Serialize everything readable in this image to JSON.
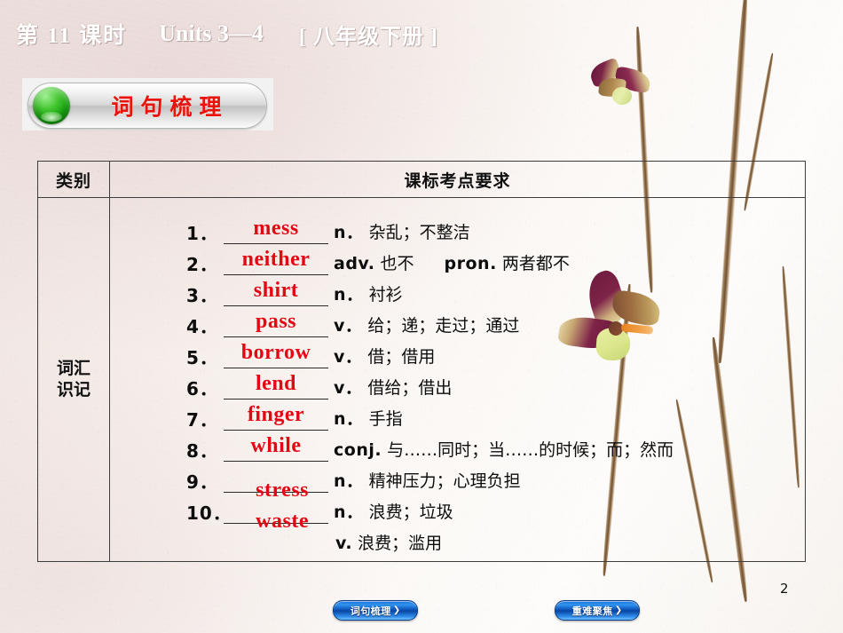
{
  "header": {
    "lesson": "第 11 课时",
    "units": "Units 3—4",
    "grade": "[ 八年级下册 ]"
  },
  "badge": {
    "label": "词句梳理",
    "ball_color": "#12a10a",
    "text_color": "#e8140c"
  },
  "table": {
    "headers": [
      "类别",
      "课标考点要求"
    ],
    "category_label": "词汇\n识记",
    "rows": [
      {
        "num": "1．",
        "word": "mess",
        "pos": "n．",
        "cn": "杂乱；不整洁",
        "pos2": "",
        "cn2": "",
        "word_low": false
      },
      {
        "num": "2．",
        "word": "neither",
        "pos": "adv.",
        "cn": "也不",
        "pos2": "pron.",
        "cn2": "两者都不",
        "word_low": false
      },
      {
        "num": "3．",
        "word": "shirt",
        "pos": "n．",
        "cn": "衬衫",
        "pos2": "",
        "cn2": "",
        "word_low": false
      },
      {
        "num": "4．",
        "word": "pass",
        "pos": "v．",
        "cn": "给；递；走过；通过",
        "pos2": "",
        "cn2": "",
        "word_low": false
      },
      {
        "num": "5．",
        "word": "borrow",
        "pos": "v．",
        "cn": "借；借用",
        "pos2": "",
        "cn2": "",
        "word_low": false
      },
      {
        "num": "6．",
        "word": "lend",
        "pos": "v．",
        "cn": "借给；借出",
        "pos2": "",
        "cn2": "",
        "word_low": false
      },
      {
        "num": "7．",
        "word": "finger",
        "pos": "n．",
        "cn": "手指",
        "pos2": "",
        "cn2": "",
        "word_low": false
      },
      {
        "num": "8．",
        "word": "while",
        "pos": "conj.",
        "cn": "与……同时；当……的时候；而；然而",
        "pos2": "",
        "cn2": "",
        "word_low": false
      },
      {
        "num": "9．",
        "word": "stress",
        "pos": "n．",
        "cn": "精神压力；心理负担",
        "pos2": "",
        "cn2": "",
        "word_low": true
      },
      {
        "num": "10．",
        "word": "waste",
        "pos": "n．",
        "cn": "浪费；垃圾",
        "pos2": "",
        "cn2": "",
        "word_low": true
      }
    ],
    "extra_line": {
      "pos": "v.",
      "cn": "浪费；滥用"
    }
  },
  "footer": {
    "nav_left": "词句梳理",
    "nav_right": "重难聚焦",
    "chevron": "❯",
    "page_number": "2"
  }
}
